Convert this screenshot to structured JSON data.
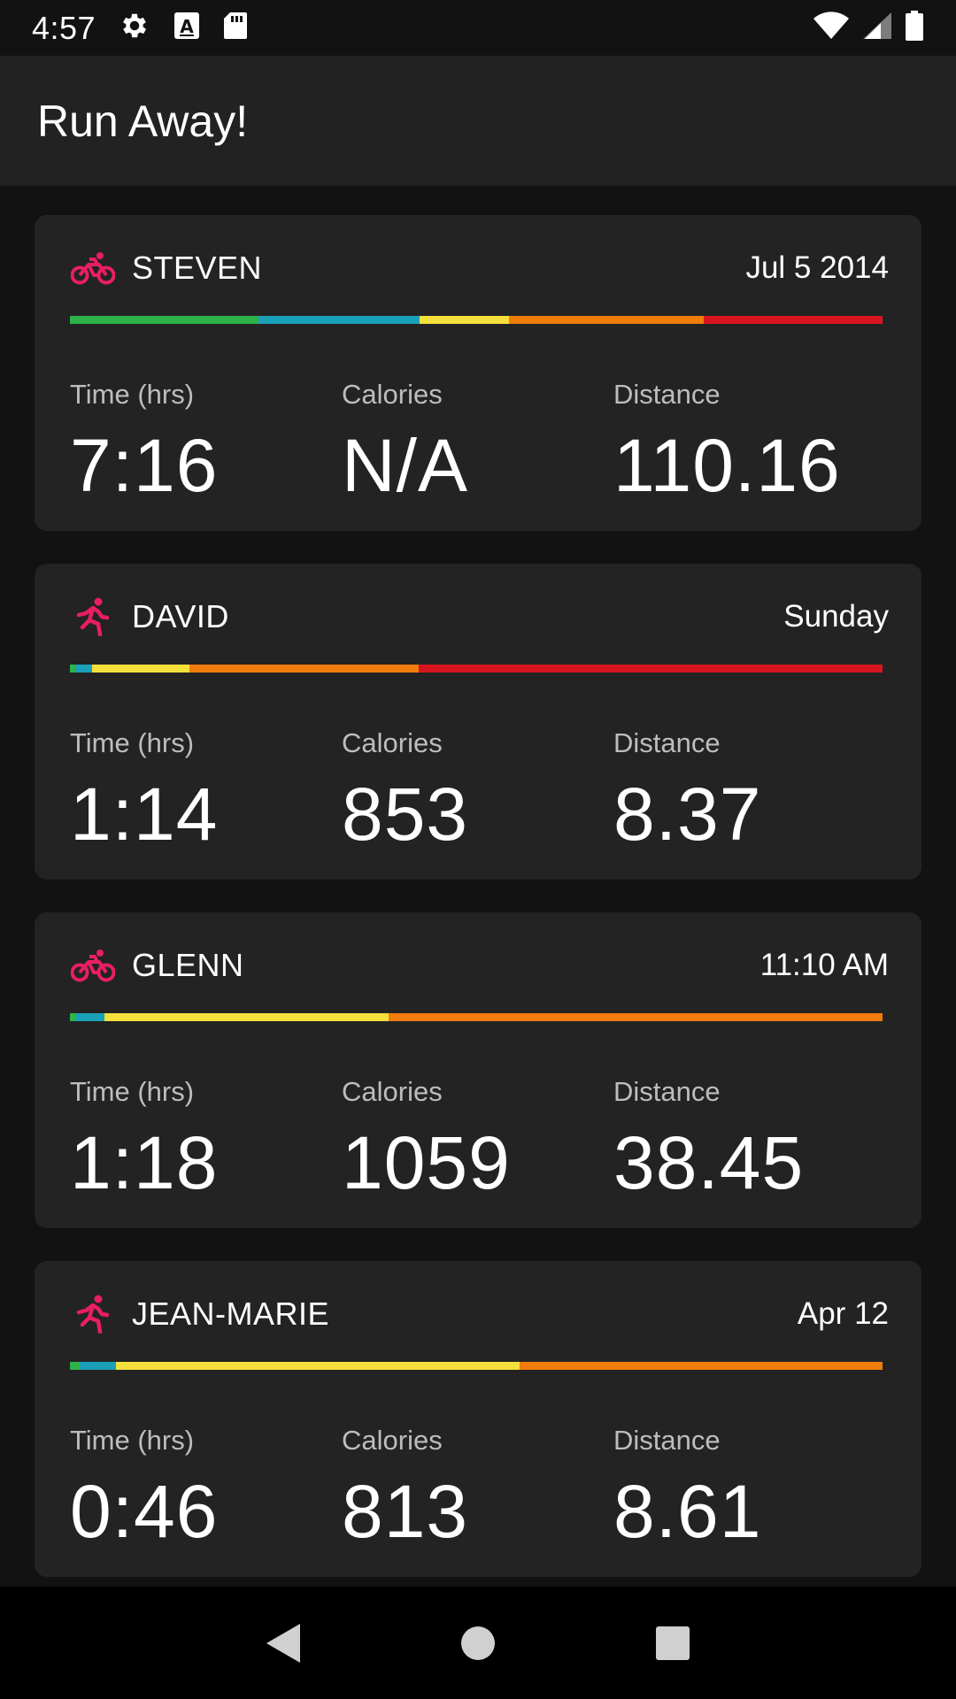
{
  "status_bar": {
    "time": "4:57",
    "left_icons": [
      "gear-icon",
      "font-a-icon",
      "sd-card-icon"
    ],
    "right_icons": [
      "wifi-icon",
      "cell-signal-icon",
      "battery-icon"
    ]
  },
  "app_bar": {
    "title": "Run Away!"
  },
  "colors": {
    "accent": "#e91e63",
    "background": "#121212",
    "card": "#232323",
    "app_bar": "#222222",
    "zone_1": "#2cb34a",
    "zone_2": "#1aa0b8",
    "zone_3": "#f5e03b",
    "zone_4": "#f07c0c",
    "zone_5": "#d7151f"
  },
  "cards": [
    {
      "activity_icon": "bike-icon",
      "name": "STEVEN",
      "date": "Jul 5 2014",
      "zones": [
        0.232,
        0.198,
        0.11,
        0.24,
        0.22
      ],
      "stats": [
        {
          "label": "Time (hrs)",
          "value": "7:16"
        },
        {
          "label": "Calories",
          "value": "N/A"
        },
        {
          "label": "Distance",
          "value": "110.16"
        }
      ]
    },
    {
      "activity_icon": "run-icon",
      "name": "DAVID",
      "date": "Sunday",
      "zones": [
        0.007,
        0.02,
        0.12,
        0.282,
        0.571
      ],
      "stats": [
        {
          "label": "Time (hrs)",
          "value": "1:14"
        },
        {
          "label": "Calories",
          "value": "853"
        },
        {
          "label": "Distance",
          "value": "8.37"
        }
      ]
    },
    {
      "activity_icon": "bike-icon",
      "name": "GLENN",
      "date": "11:10 AM",
      "zones": [
        0.008,
        0.034,
        0.35,
        0.608,
        0.0
      ],
      "stats": [
        {
          "label": "Time (hrs)",
          "value": "1:18"
        },
        {
          "label": "Calories",
          "value": "1059"
        },
        {
          "label": "Distance",
          "value": "38.45"
        }
      ]
    },
    {
      "activity_icon": "run-icon",
      "name": "JEAN-MARIE",
      "date": "Apr 12",
      "zones": [
        0.012,
        0.045,
        0.496,
        0.447,
        0.0
      ],
      "stats": [
        {
          "label": "Time (hrs)",
          "value": "0:46"
        },
        {
          "label": "Calories",
          "value": "813"
        },
        {
          "label": "Distance",
          "value": "8.61"
        }
      ]
    }
  ],
  "nav_bar": {
    "buttons": [
      "back-icon",
      "home-icon",
      "recents-icon"
    ]
  }
}
